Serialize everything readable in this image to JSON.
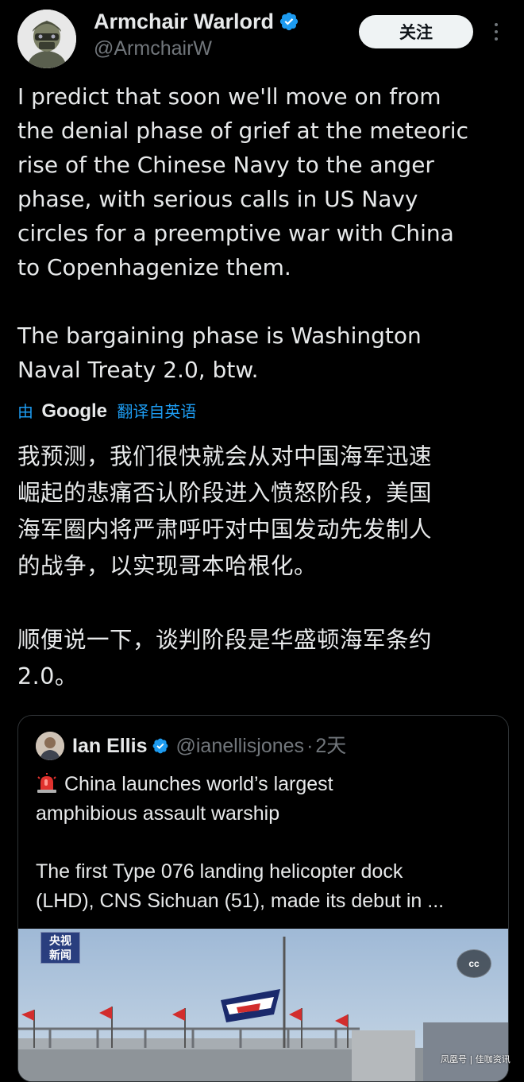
{
  "author": {
    "display_name": "Armchair Warlord",
    "handle": "@ArmchairW",
    "verified": true
  },
  "header": {
    "follow_label": "关注",
    "more_icon": "more-vertical-icon"
  },
  "tweet": {
    "text_lines": [
      "I predict that soon we'll move on from",
      "the denial phase of grief at the meteoric",
      "rise of the Chinese Navy to the anger",
      "phase, with serious calls in US Navy",
      "circles for a preemptive war with China",
      "to Copenhagenize them."
    ],
    "text_para2_lines": [
      "The bargaining phase is Washington",
      "Naval Treaty 2.0, btw."
    ],
    "translation": {
      "by": "由",
      "provider": "Google",
      "label": "翻译自英语"
    },
    "translated_lines": [
      "我预测，我们很快就会从对中国海军迅速",
      "崛起的悲痛否认阶段进入愤怒阶段，美国",
      "海军圈内将严肃呼吁对中国发动先发制人",
      "的战争，以实现哥本哈根化。"
    ],
    "translated_para2_lines": [
      "顺便说一下，谈判阶段是华盛顿海军条约",
      "2.0。"
    ]
  },
  "quote": {
    "display_name": "Ian Ellis",
    "handle": "@ianellisjones",
    "separator": "·",
    "time": "2天",
    "verified": true,
    "headline_lines": [
      "China launches world’s largest",
      "amphibious assault warship"
    ],
    "body_lines": [
      "The first Type 076 landing helicopter dock",
      "(LHD), CNS Sichuan (51), made its debut in ..."
    ],
    "media": {
      "badge_line1": "央视",
      "badge_line2": "新闻",
      "cc_label": "cc"
    }
  },
  "watermark": "凤凰号 | 佳咖资讯",
  "colors": {
    "background": "#000000",
    "text": "#e7e9ea",
    "muted": "#71767b",
    "link": "#1d9bf0",
    "verified": "#1d9bf0",
    "border": "#2f3336"
  }
}
